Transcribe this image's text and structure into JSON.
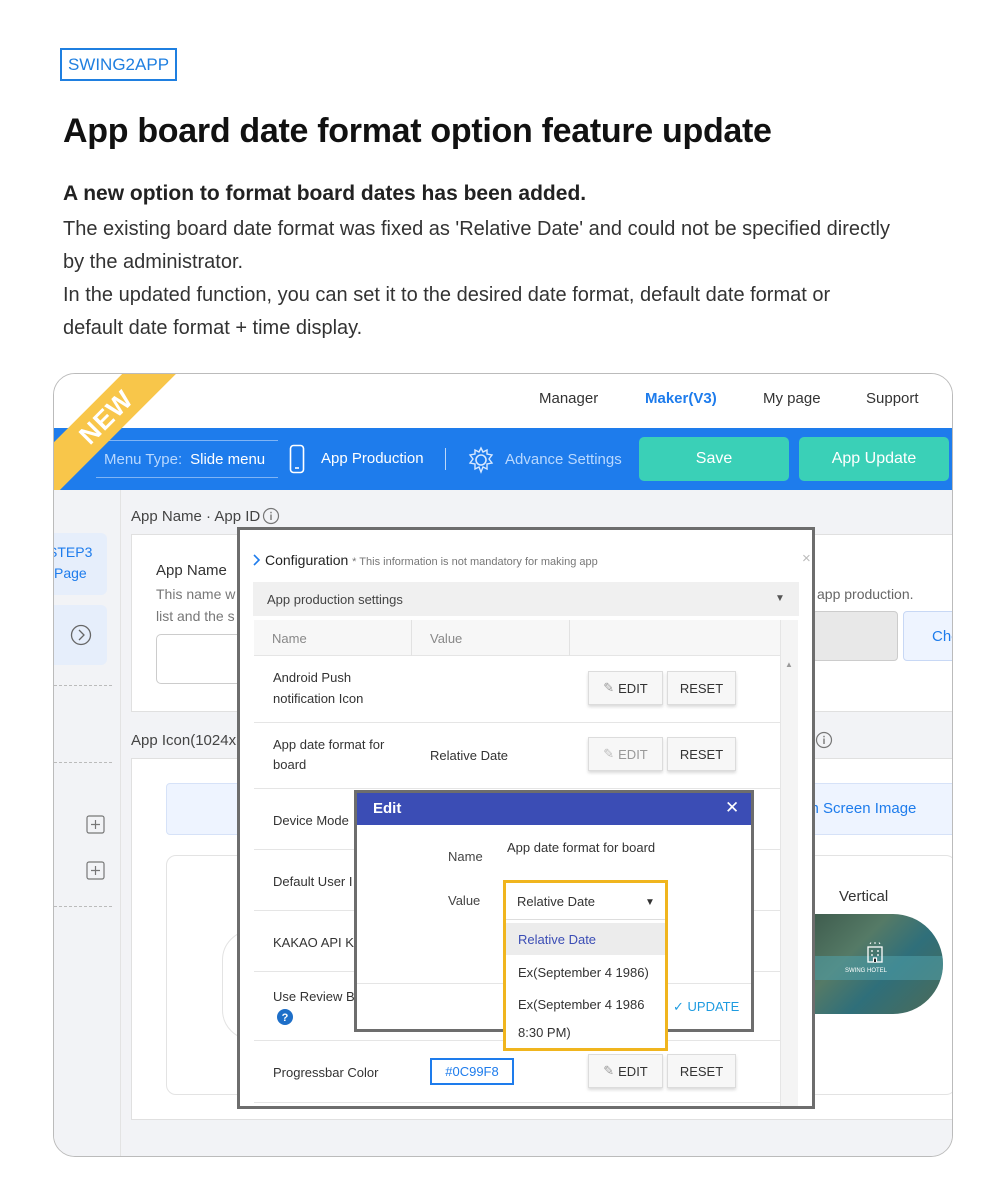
{
  "brand": "SWING2APP",
  "headline": "App board date format option feature update",
  "lead": "A new option to format board dates has been added.",
  "paragraphs": [
    "The existing board date format  was fixed as 'Relative Date' and could not be specified directly",
    "by the administrator.",
    "In the updated function, you can set it to the desired date format, default date format or",
    "default date format + time display."
  ],
  "ribbon": "NEW",
  "nav": {
    "manager": "Manager",
    "maker": "Maker(V3)",
    "mypage": "My page",
    "support": "Support"
  },
  "toolbar": {
    "menu_type_label": "Menu Type:",
    "menu_type_value": "Slide menu",
    "app_production": "App Production",
    "advance_settings": "Advance Settings",
    "save": "Save",
    "app_update": "App Update"
  },
  "left": {
    "step_title": "STEP3",
    "step_sub": "Page"
  },
  "bg": {
    "app_name_id": "App Name · App ID",
    "app_name": "App Name",
    "app_name_desc_1": "This name w",
    "app_name_desc_2": "list and the s",
    "app_production_text": "app production.",
    "check_btn": "Che",
    "app_icon": "App Icon(1024x",
    "splash": "sh Screen Image",
    "vertical": "Vertical",
    "hotel_logo": "SWING HOTEL"
  },
  "config": {
    "title": "Configuration",
    "subtitle": "* This information is not mandatory for making app",
    "section": "App production settings",
    "col_name": "Name",
    "col_value": "Value",
    "rows": [
      {
        "name_1": "Android Push",
        "name_2": "notification Icon",
        "value": "",
        "edit": "EDIT",
        "reset": "RESET"
      },
      {
        "name_1": "App date format for",
        "name_2": "board",
        "value": "Relative Date",
        "edit": "EDIT",
        "reset": "RESET"
      },
      {
        "name_1": "Device Mode"
      },
      {
        "name_1": "Default User I"
      },
      {
        "name_1": "KAKAO API KE"
      },
      {
        "name_1": "Use Review Bu"
      },
      {
        "name_1": "Progressbar Color",
        "value": "#0C99F8",
        "edit": "EDIT",
        "reset": "RESET"
      }
    ]
  },
  "edit": {
    "title": "Edit",
    "name_label": "Name",
    "name_value": "App date format for board",
    "value_label": "Value",
    "selected": "Relative Date",
    "options": [
      "Relative Date",
      "Ex(September 4 1986)",
      "Ex(September 4 1986",
      "8:30 PM)"
    ],
    "update": "UPDATE"
  },
  "colors": {
    "accent": "#1e7cec",
    "green": "#3ad0b7",
    "ribbon": "#f8c64a",
    "modal_head": "#3b4db5",
    "highlight": "#f0b51e"
  }
}
